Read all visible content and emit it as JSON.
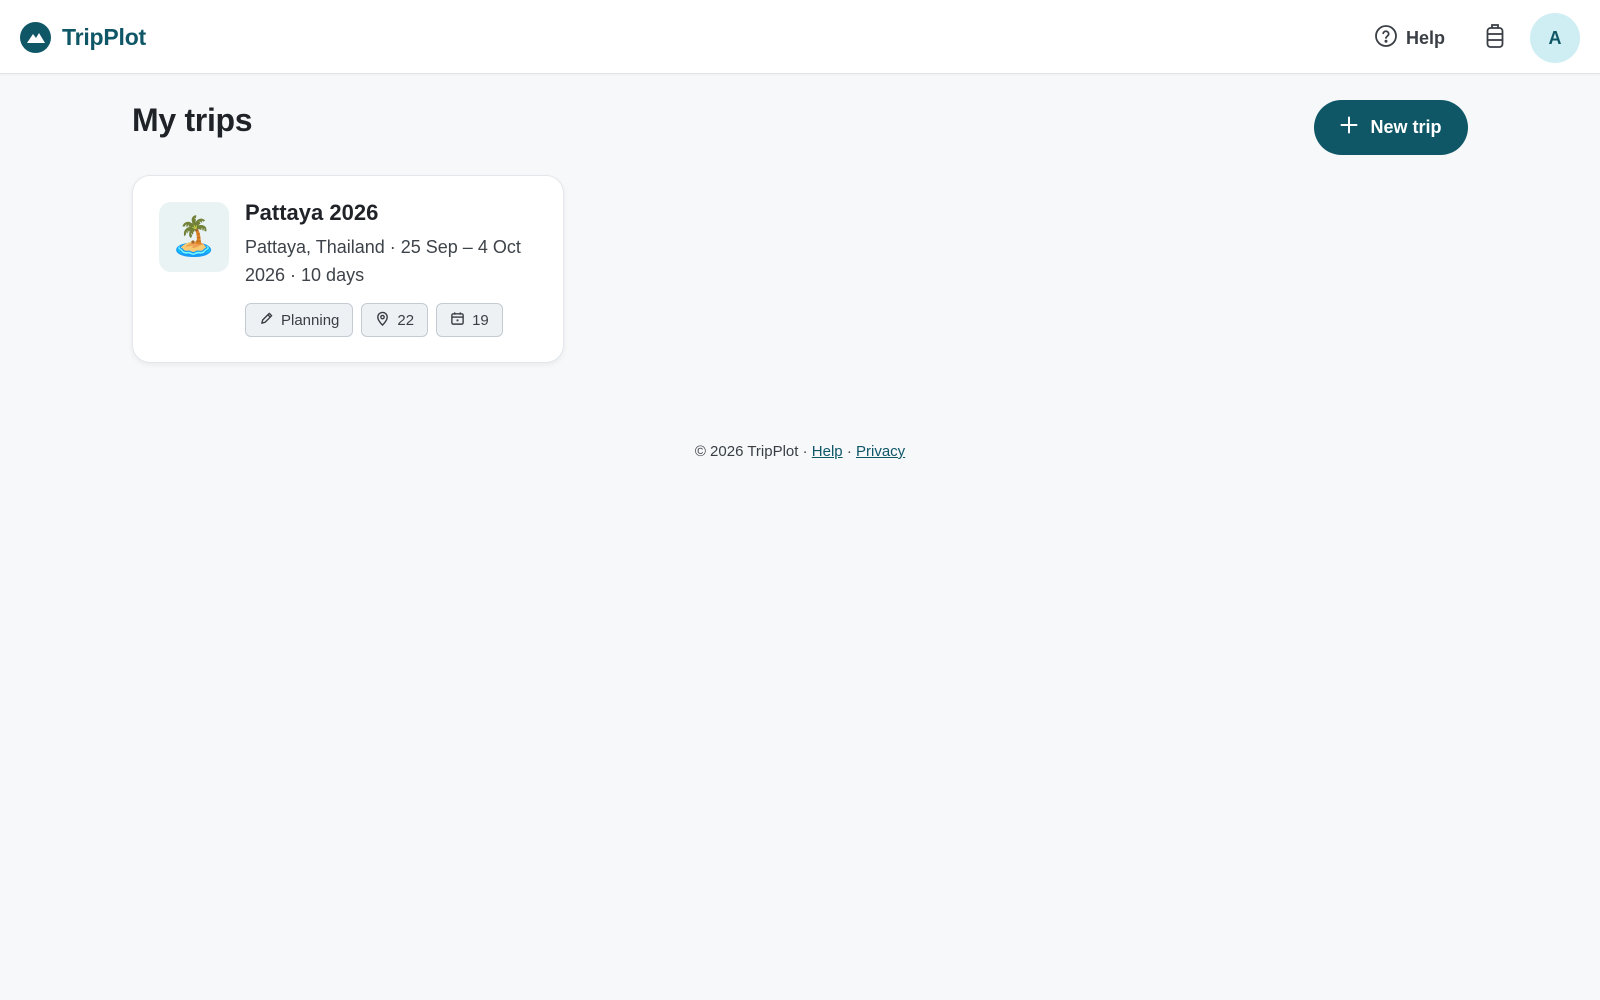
{
  "header": {
    "brand_name": "TripPlot",
    "help_label": "Help",
    "trips_icon": "luggage-icon",
    "avatar_initial": "A"
  },
  "main": {
    "title": "My trips",
    "new_trip_label": "New trip",
    "trips": [
      {
        "emoji": "🏝️",
        "name": "Pattaya 2026",
        "meta": "Pattaya, Thailand · 25 Sep – 4 Oct 2026 · 10 days",
        "status": "Planning",
        "places_count": "22",
        "days_count": "19"
      }
    ]
  },
  "footer": {
    "copyright": "© 2026 TripPlot ·",
    "sep": "·",
    "help_link": "Help",
    "privacy_link": "Privacy"
  },
  "colors": {
    "brand": "#0f5767",
    "background": "#f6f8fa",
    "avatar_bg": "#cfeef3"
  }
}
